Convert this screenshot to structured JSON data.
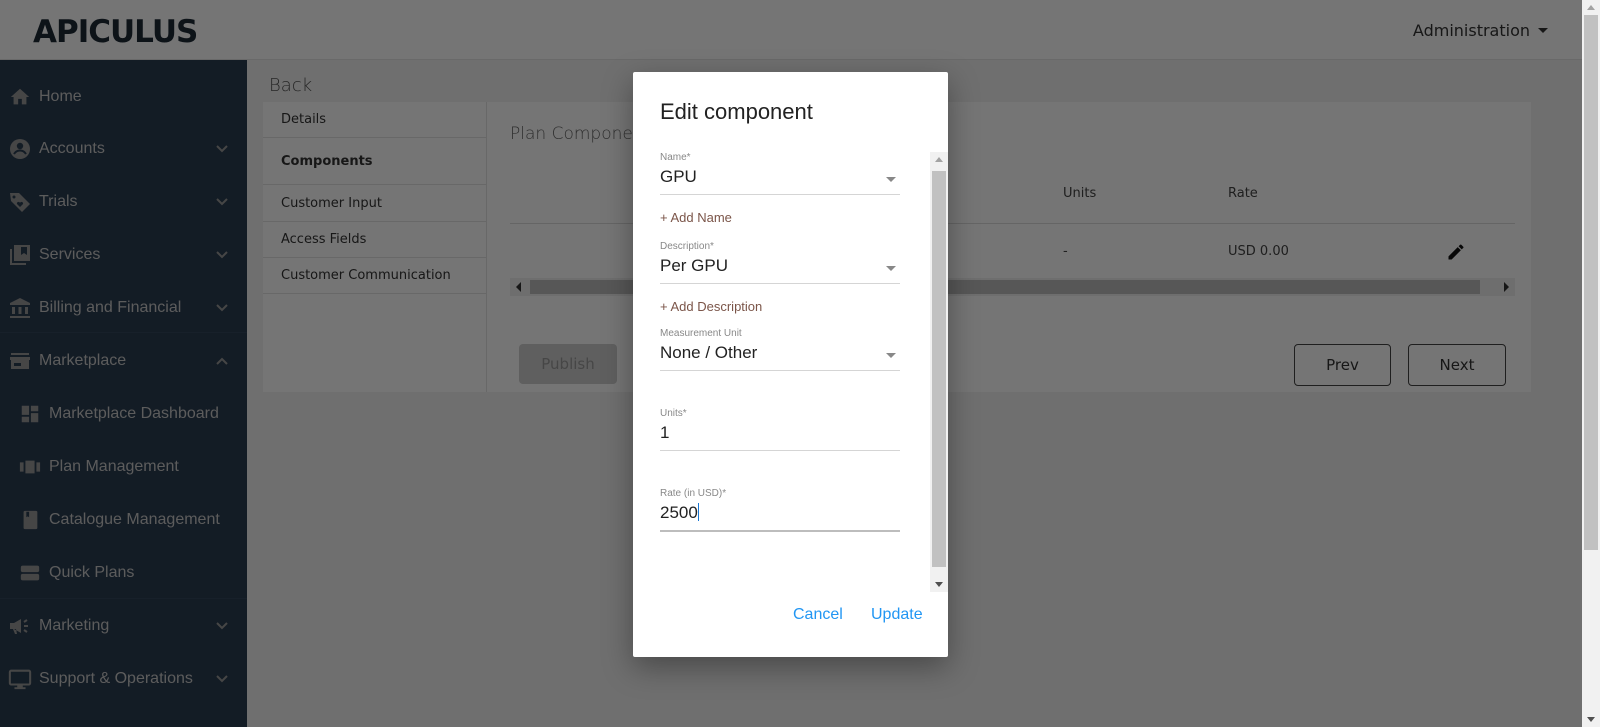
{
  "header": {
    "logo_text": "APICULUS",
    "admin_menu_label": "Administration"
  },
  "sidebar": {
    "items": [
      {
        "label": "Home",
        "icon": "home-icon"
      },
      {
        "label": "Accounts",
        "icon": "account-circle-icon",
        "expandable": true
      },
      {
        "label": "Trials",
        "icon": "tag-heart-icon",
        "expandable": true
      },
      {
        "label": "Services",
        "icon": "library-icon",
        "expandable": true
      },
      {
        "label": "Billing and Financial",
        "icon": "bank-icon",
        "expandable": true
      },
      {
        "label": "Marketplace",
        "icon": "store-icon",
        "expandable": true,
        "expanded": true
      },
      {
        "label": "Marketplace Dashboard",
        "icon": "dashboard-icon",
        "sub": true
      },
      {
        "label": "Plan Management",
        "icon": "carousel-icon",
        "sub": true
      },
      {
        "label": "Catalogue Management",
        "icon": "book-icon",
        "sub": true
      },
      {
        "label": "Quick Plans",
        "icon": "storage-icon",
        "sub": true
      },
      {
        "label": "Marketing",
        "icon": "megaphone-icon",
        "expandable": true
      },
      {
        "label": "Support & Operations",
        "icon": "monitor-icon",
        "expandable": true
      }
    ]
  },
  "main": {
    "back_label": "Back",
    "tabs": [
      {
        "label": "Details",
        "active": false
      },
      {
        "label": "Components",
        "active": true
      },
      {
        "label": "Customer Input",
        "active": false
      },
      {
        "label": "Access Fields",
        "active": false
      },
      {
        "label": "Customer Communication",
        "active": false
      }
    ],
    "section_title": "Plan Components",
    "table": {
      "headers": {
        "units": "Units",
        "rate": "Rate"
      },
      "rows": [
        {
          "units": "-",
          "rate": "USD 0.00"
        }
      ]
    },
    "buttons": {
      "publish": "Publish",
      "prev": "Prev",
      "next": "Next"
    }
  },
  "dialog": {
    "title": "Edit component",
    "fields": {
      "name": {
        "label": "Name*",
        "value": "GPU"
      },
      "add_name": "+ Add Name",
      "description": {
        "label": "Description*",
        "value": "Per GPU"
      },
      "add_description": "+ Add Description",
      "measurement_unit": {
        "label": "Measurement Unit",
        "value": "None / Other"
      },
      "units": {
        "label": "Units*",
        "value": "1"
      },
      "rate": {
        "label": "Rate (in USD)*",
        "value": "2500"
      }
    },
    "buttons": {
      "cancel": "Cancel",
      "update": "Update"
    }
  },
  "colors": {
    "sidebar_bg": "#2b3d52",
    "link_brown": "#7b5549",
    "dialog_action_blue": "#2196f3"
  }
}
